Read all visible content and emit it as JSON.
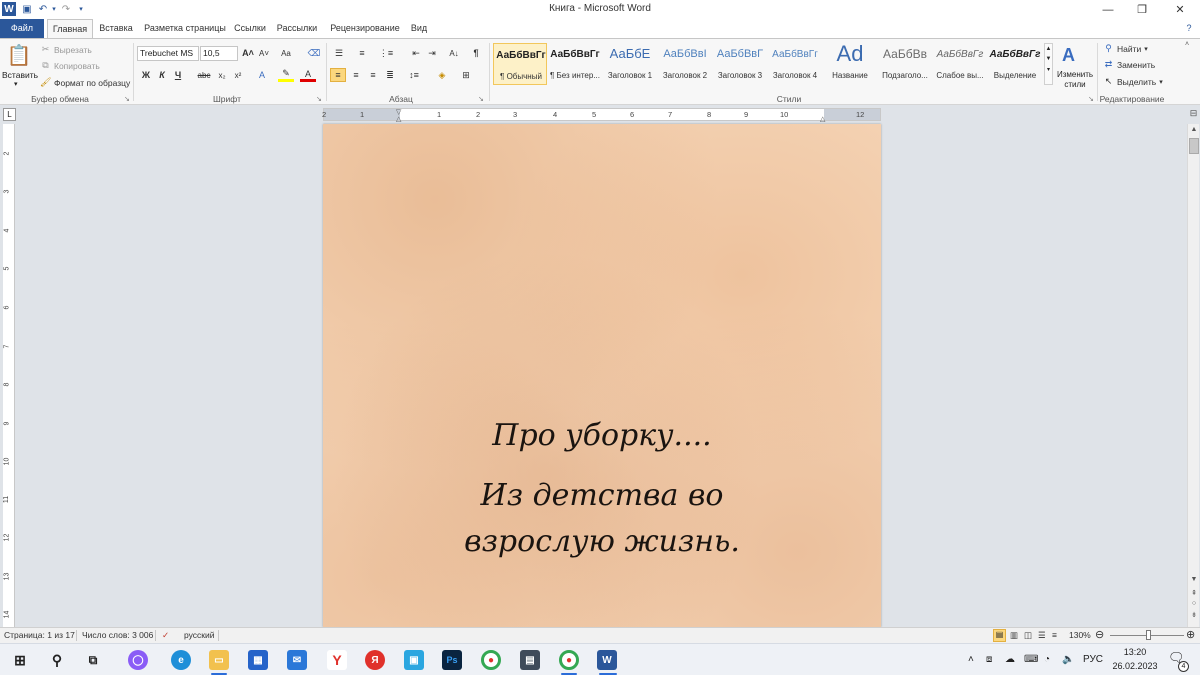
{
  "titlebar": {
    "title": "Книга - Microsoft Word",
    "minimize": "—",
    "maximize": "❐",
    "close": "✕"
  },
  "tabs": [
    {
      "label": "Файл"
    },
    {
      "label": "Главная"
    },
    {
      "label": "Вставка"
    },
    {
      "label": "Разметка страницы"
    },
    {
      "label": "Ссылки"
    },
    {
      "label": "Рассылки"
    },
    {
      "label": "Рецензирование"
    },
    {
      "label": "Вид"
    }
  ],
  "clipboard": {
    "paste": "Вставить",
    "cut": "Вырезать",
    "copy": "Копировать",
    "format_painter": "Формат по образцу",
    "group": "Буфер обмена"
  },
  "font": {
    "family": "Trebuchet MS",
    "size": "10,5",
    "group": "Шрифт"
  },
  "paragraph": {
    "group": "Абзац"
  },
  "styles": {
    "group": "Стили",
    "items": [
      {
        "sample": "АаБбВвГг",
        "name": "¶ Обычный",
        "selected": true
      },
      {
        "sample": "АаБбВвГг",
        "name": "¶ Без интер..."
      },
      {
        "sample": "АаБбЕ",
        "name": "Заголовок 1"
      },
      {
        "sample": "АаБбВвI",
        "name": "Заголовок 2"
      },
      {
        "sample": "АаБбВвГ",
        "name": "Заголовок 3"
      },
      {
        "sample": "АаБбВвГг",
        "name": "Заголовок 4"
      },
      {
        "sample": "Ad",
        "name": "Название"
      },
      {
        "sample": "АаБбВв",
        "name": "Подзаголо..."
      },
      {
        "sample": "АаБбВвГг",
        "name": "Слабое вы..."
      },
      {
        "sample": "АаБбВвГг",
        "name": "Выделение"
      }
    ],
    "change": "Изменить стили"
  },
  "editing": {
    "find": "Найти",
    "replace": "Заменить",
    "select": "Выделить",
    "group": "Редактирование"
  },
  "ruler": {
    "numbers": [
      "2",
      "1",
      "1",
      "2",
      "3",
      "4",
      "5",
      "6",
      "7",
      "8",
      "9",
      "10",
      "12"
    ]
  },
  "vruler": {
    "numbers": [
      "2",
      "3",
      "4",
      "5",
      "6",
      "7",
      "8",
      "9",
      "10",
      "11",
      "12",
      "13",
      "14"
    ]
  },
  "document": {
    "line1": "Про уборку....",
    "line2": "Из детства во",
    "line3": "взрослую жизнь."
  },
  "status": {
    "page": "Страница: 1 из 17",
    "words": "Число слов: 3 006",
    "language": "русский",
    "zoom": "130%"
  },
  "taskbar": {
    "lang": "РУС",
    "time": "13:20",
    "date": "26.02.2023",
    "notifications": "4"
  }
}
